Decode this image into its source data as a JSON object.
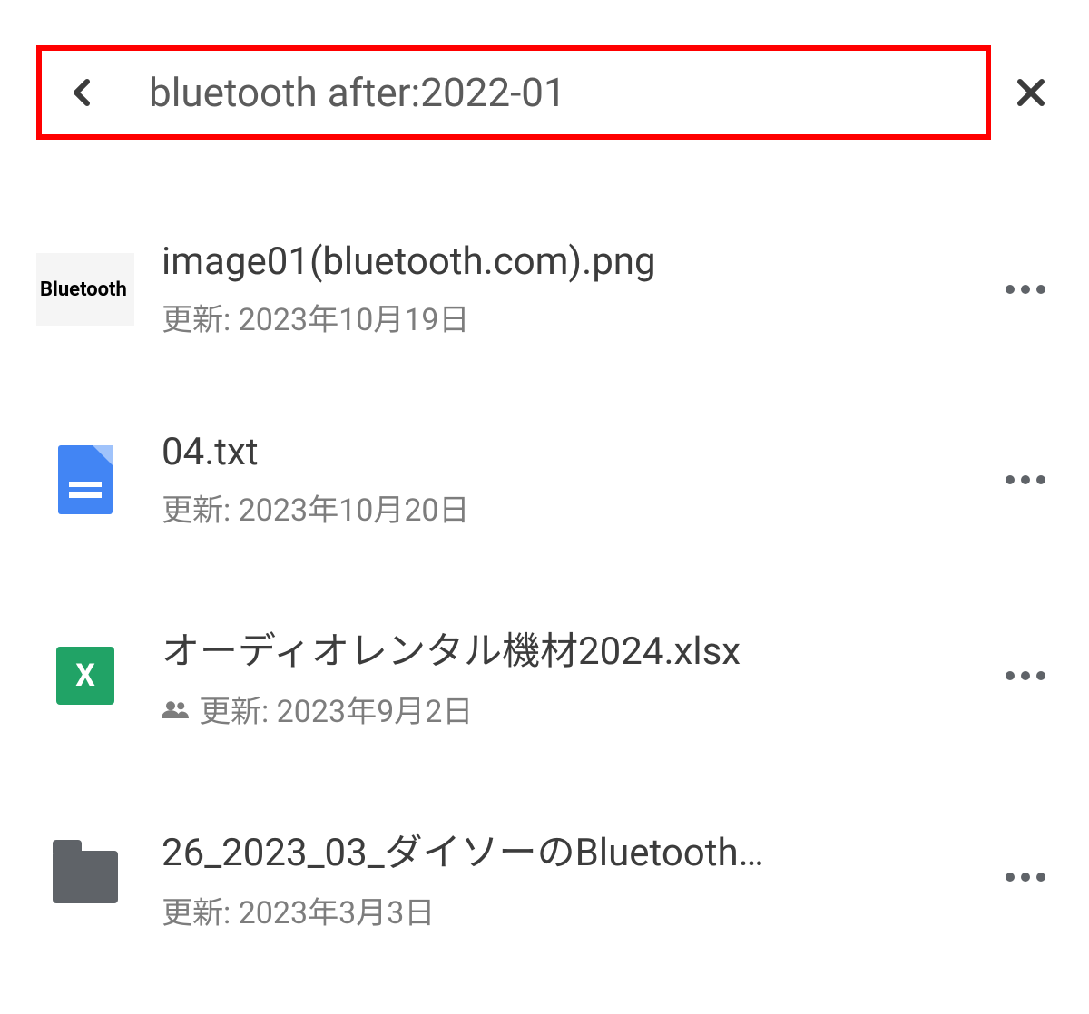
{
  "search": {
    "query": "bluetooth  after:2022-01"
  },
  "results": [
    {
      "thumb_type": "bluetooth",
      "thumb_label": "Bluetooth",
      "name": "image01(bluetooth.com).png",
      "meta": "更新: 2023年10月19日",
      "shared": false
    },
    {
      "thumb_type": "doc",
      "thumb_label": "",
      "name": "04.txt",
      "meta": "更新: 2023年10月20日",
      "shared": false
    },
    {
      "thumb_type": "excel",
      "thumb_label": "X",
      "name": "オーディオレンタル機材2024.xlsx",
      "meta": "更新: 2023年9月2日",
      "shared": true
    },
    {
      "thumb_type": "folder",
      "thumb_label": "",
      "name": "26_2023_03_ダイソーのBluetooth…",
      "meta": "更新: 2023年3月3日",
      "shared": false
    }
  ]
}
